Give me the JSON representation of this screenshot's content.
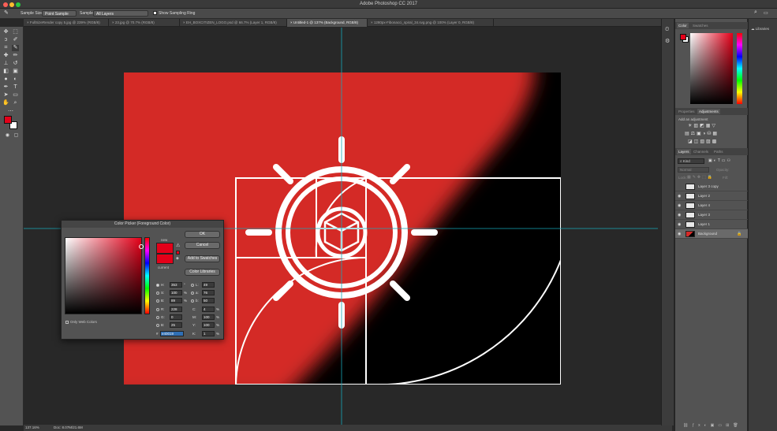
{
  "app": {
    "title": "Adobe Photoshop CC 2017"
  },
  "options_bar": {
    "sample_size_label": "Sample Size:",
    "sample_size_value": "Point Sample",
    "sample_label": "Sample:",
    "sample_value": "All Layers",
    "show_ring_label": "Show Sampling Ring"
  },
  "tabs": [
    "FullSizeRender copy 5.jpg @ 239% (RGB/8)",
    "23.jpg @ 70.7% (RGB/8)",
    "EH_BOXCITIZEN_LOGO.psd @ 66.7% (Layer 1, RGB/8)",
    "Untitled-1 @ 137% (Background, RGB/8)",
    "1280px-Fibonacci_spiral_34.svg.png @ 100% (Layer 0, RGB/8)"
  ],
  "status": {
    "zoom": "137.16%",
    "doc": "Doc: 8.07M/21.6M"
  },
  "panels": {
    "color_tab": "Color",
    "swatches_tab": "Swatches",
    "properties_tab": "Properties",
    "adjustments_tab": "Adjustments",
    "adjustments_hint": "Add an adjustment",
    "layers_tab": "Layers",
    "channels_tab": "Channels",
    "paths_tab": "Paths",
    "kind_filter": "Kind",
    "blend_mode": "Normal",
    "opacity_label": "Opacity:",
    "lock_label": "Lock:",
    "fill_label": "Fill:",
    "libraries": "Libraries"
  },
  "layers": [
    "Layer 3 copy",
    "Layer 2",
    "Layer 4",
    "Layer 3",
    "Layer 1",
    "Background"
  ],
  "color_picker": {
    "title": "Color Picker (Foreground Color)",
    "new_label": "new",
    "current_label": "current",
    "ok": "OK",
    "cancel": "Cancel",
    "add_to_swatches": "Add to Swatches",
    "color_libraries": "Color Libraries",
    "only_web_colors": "Only Web Colors",
    "fields": {
      "H": "353",
      "S": "100",
      "B": "89",
      "R": "228",
      "G": "0",
      "Bv": "25",
      "L": "49",
      "a": "76",
      "b": "50",
      "C": "4",
      "M": "100",
      "Y": "100",
      "K": "1",
      "hex": "e40019"
    },
    "units": {
      "deg": "°",
      "pct": "%"
    },
    "labels": {
      "H": "H:",
      "S": "S:",
      "B": "B:",
      "R": "R:",
      "G": "G:",
      "Bv": "B:",
      "L": "L:",
      "a": "a:",
      "b": "b:",
      "C": "C:",
      "M": "M:",
      "Y": "Y:",
      "K": "K:",
      "hex": "#"
    }
  },
  "colors": {
    "foreground": "#e40019",
    "background": "#ffffff",
    "canvas_red": "#d42a28"
  }
}
